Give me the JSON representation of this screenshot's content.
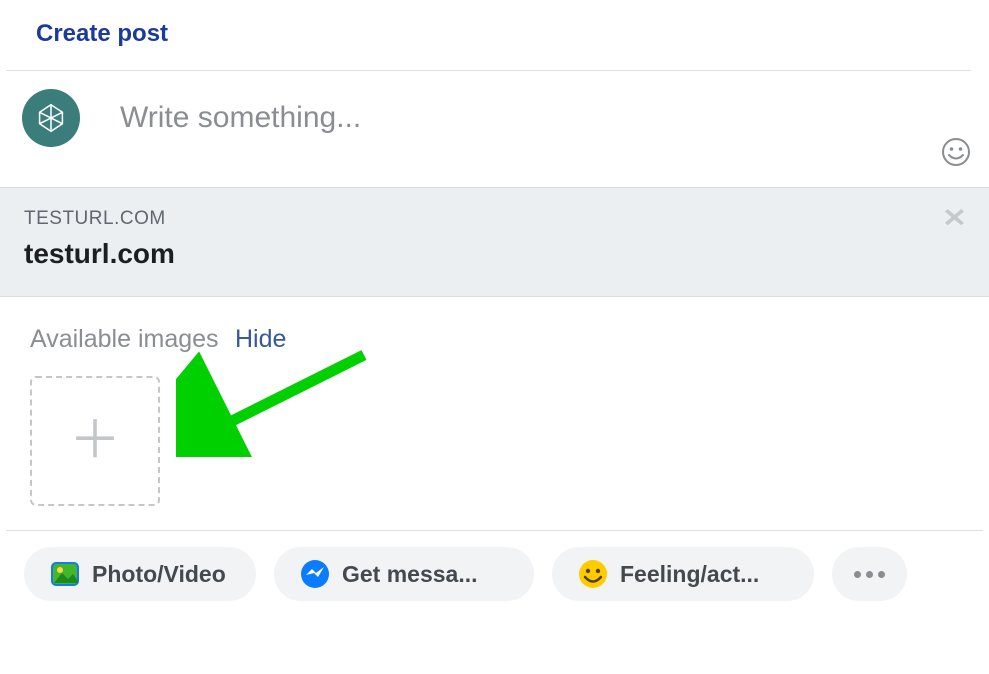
{
  "header": {
    "title": "Create post"
  },
  "compose": {
    "placeholder": "Write something..."
  },
  "preview": {
    "domain": "TESTURL.COM",
    "title": "testurl.com"
  },
  "images": {
    "label": "Available images",
    "hide": "Hide"
  },
  "actions": {
    "photo": "Photo/Video",
    "messages": "Get messa...",
    "feeling": "Feeling/act..."
  }
}
